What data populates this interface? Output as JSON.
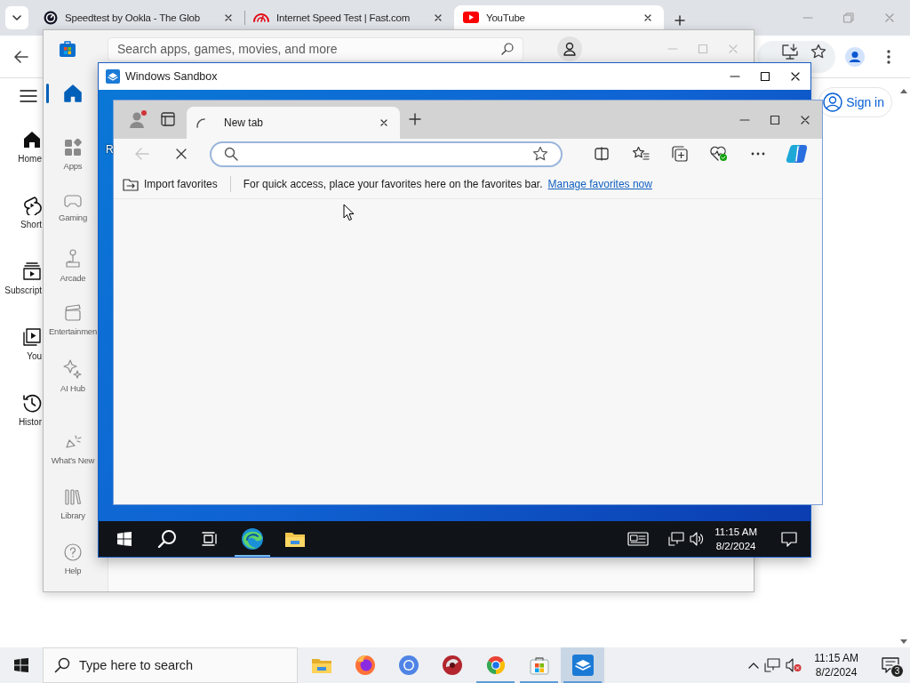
{
  "chrome": {
    "tabs": [
      {
        "kind": "speedtest",
        "title": "Speedtest by Ookla - The Glob",
        "selected": false
      },
      {
        "kind": "fast",
        "title": "Internet Speed Test | Fast.com",
        "selected": false
      },
      {
        "kind": "youtube",
        "title": "YouTube",
        "selected": true
      }
    ],
    "youtube": {
      "nav": [
        {
          "kind": "home",
          "label": "Home"
        },
        {
          "kind": "shorts",
          "label": "Short"
        },
        {
          "kind": "subscriptions",
          "label": "Subscript"
        },
        {
          "kind": "you",
          "label": "You"
        },
        {
          "kind": "history",
          "label": "Histor"
        }
      ],
      "sign_in": "Sign in"
    }
  },
  "store": {
    "search": {
      "placeholder": "Search apps, games, movies, and more"
    },
    "nav": [
      {
        "kind": "home",
        "selected": true
      },
      {
        "kind": "apps",
        "label": "Apps",
        "selected": false
      },
      {
        "kind": "gaming",
        "label": "Gaming",
        "selected": false
      },
      {
        "kind": "arcade",
        "label": "Arcade",
        "selected": false
      },
      {
        "kind": "entertainment",
        "label": "Entertainmen",
        "selected": false
      },
      {
        "kind": "ai",
        "label": "AI Hub",
        "selected": false
      },
      {
        "kind": "new",
        "label": "What's New",
        "selected": false
      },
      {
        "kind": "library",
        "label": "Library",
        "selected": false
      },
      {
        "kind": "help",
        "label": "Help",
        "selected": false
      }
    ]
  },
  "sandbox": {
    "title": "Windows Sandbox",
    "desktop_icon_label": "R",
    "edge": {
      "tab": {
        "title": "New tab",
        "loading": true
      },
      "back_button": {
        "disabled": true
      },
      "favorites_bar": {
        "import": "Import favorites",
        "message": "For quick access, place your favorites here on the favorites bar.",
        "link": "Manage favorites now"
      }
    },
    "taskbar": {
      "apps": [
        {
          "kind": "edge",
          "running": true
        },
        {
          "kind": "explorer",
          "running": false
        }
      ],
      "time": "11:15 AM",
      "date": "8/2/2024"
    }
  },
  "taskbar": {
    "search": {
      "placeholder": "Type here to search"
    },
    "apps": [
      {
        "kind": "explorer",
        "running": false,
        "selected": false
      },
      {
        "kind": "firefox",
        "running": false,
        "selected": false
      },
      {
        "kind": "chromium",
        "running": false,
        "selected": false
      },
      {
        "kind": "red-circle",
        "running": false,
        "selected": false
      },
      {
        "kind": "chrome",
        "running": true,
        "selected": false
      },
      {
        "kind": "store",
        "running": true,
        "selected": false
      },
      {
        "kind": "sandbox",
        "running": true,
        "selected": true
      }
    ],
    "volume": {
      "muted": true
    },
    "time": "11:15 AM",
    "date": "8/2/2024",
    "notifications": "3"
  }
}
